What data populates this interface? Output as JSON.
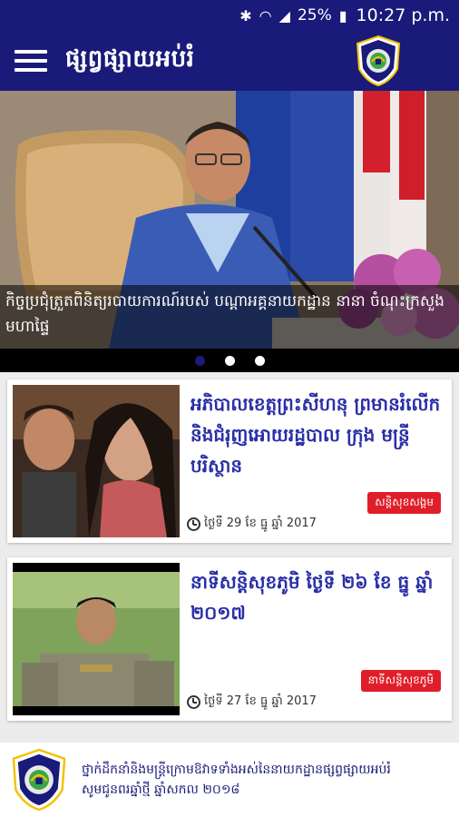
{
  "status_bar": {
    "bluetooth_icon": "bluetooth-icon",
    "wifi_icon": "wifi-icon",
    "signal_icon": "signal-icon",
    "battery": "25%",
    "battery_icon": "battery-icon",
    "time": "10:27 p.m."
  },
  "app_bar": {
    "menu_icon": "hamburger-menu-icon",
    "title": "ផ្សព្វផ្សាយអប់រំ",
    "logo_icon": "police-emblem-logo"
  },
  "carousel": {
    "caption": "កិច្ចប្រជុំត្រួតពិនិត្យរបាយការណ៍របស់ បណ្តាអគ្គនាយកដ្ឋាន នានា ចំណុះក្រសួងមហាផ្ទៃ",
    "slides": 3,
    "active_slide": 1
  },
  "articles": [
    {
      "title": "អភិបាលខេត្តព្រះសីហនុ ព្រមានរំលើកនិងជំរុញអោយរដ្ឋបាល ក្រុង មន្ត្រីបរិស្ថាន",
      "category": "សន្តិសុខសង្គម",
      "date": "ថ្ងៃទី 29 ខែ ធ្នូ ឆ្នាំ 2017"
    },
    {
      "title": "នាទីសន្តិសុខភូមិ ថ្ងៃទី ២៦ ខែ ធ្នូ ឆ្នាំ ២០១៧",
      "category": "នាទីសន្តិសុខភូមិ",
      "date": "ថ្ងៃទី 27 ខែ ធ្នូ ឆ្នាំ 2017"
    }
  ],
  "banner": {
    "line1": "ថ្នាក់ដឹកនាំនិងមន្ត្រីក្រោមឱវាទទាំងអស់នៃនាយកដ្ឋានផ្សព្វផ្សាយអប់រំ",
    "line2": "សូមជូនពរឆ្នាំថ្មី ឆ្នាំសកល ២០១៨"
  },
  "colors": {
    "primary": "#1a1a7a",
    "title_link": "#2a2fa8",
    "badge": "#e01e2a"
  }
}
